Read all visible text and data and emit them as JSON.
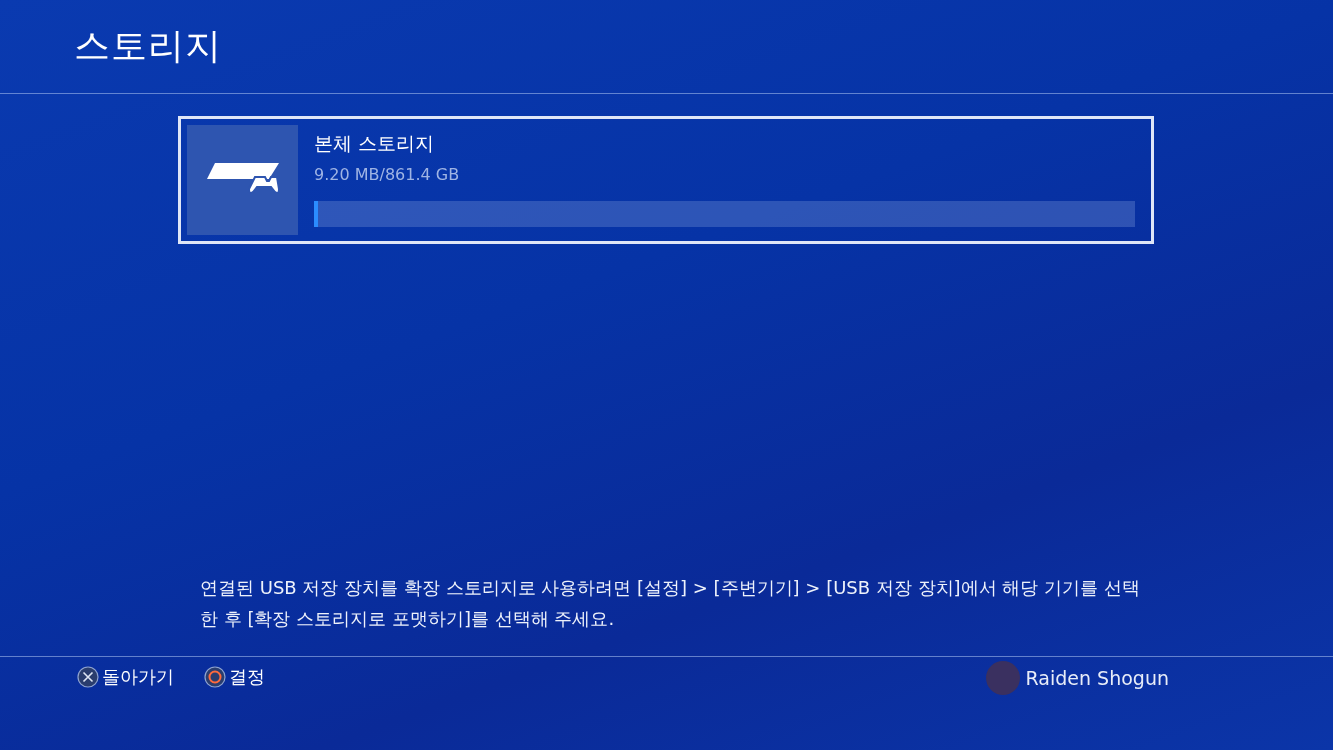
{
  "header": {
    "title": "스토리지"
  },
  "storage_items": [
    {
      "name": "본체 스토리지",
      "usage": "9.20 MB/861.4 GB",
      "level": 0.005,
      "selected": true
    }
  ],
  "notice": "연결된 USB 저장 장치를 확장 스토리지로 사용하려면 [설정] > [주변기기] > [USB 저장 장치]에서 해당 기기를 선택한 후 [확장 스토리지로 포맷하기]를 선택해 주세요.",
  "footer": {
    "buttons": [
      {
        "kind": "cross",
        "label": "돌아가기"
      },
      {
        "kind": "circle",
        "label": "결정"
      }
    ],
    "user": {
      "name": "Raiden Shogun"
    }
  }
}
